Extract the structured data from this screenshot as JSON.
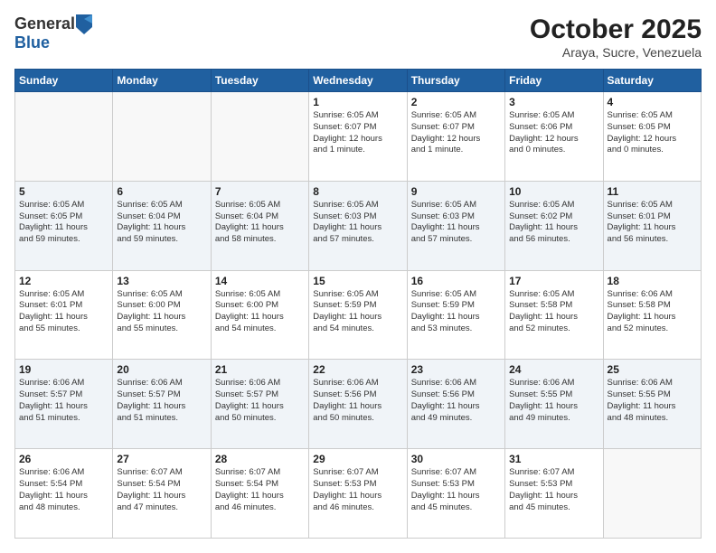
{
  "header": {
    "logo_general": "General",
    "logo_blue": "Blue",
    "month_title": "October 2025",
    "subtitle": "Araya, Sucre, Venezuela"
  },
  "weekdays": [
    "Sunday",
    "Monday",
    "Tuesday",
    "Wednesday",
    "Thursday",
    "Friday",
    "Saturday"
  ],
  "weeks": [
    [
      {
        "day": "",
        "info": ""
      },
      {
        "day": "",
        "info": ""
      },
      {
        "day": "",
        "info": ""
      },
      {
        "day": "1",
        "info": "Sunrise: 6:05 AM\nSunset: 6:07 PM\nDaylight: 12 hours\nand 1 minute."
      },
      {
        "day": "2",
        "info": "Sunrise: 6:05 AM\nSunset: 6:07 PM\nDaylight: 12 hours\nand 1 minute."
      },
      {
        "day": "3",
        "info": "Sunrise: 6:05 AM\nSunset: 6:06 PM\nDaylight: 12 hours\nand 0 minutes."
      },
      {
        "day": "4",
        "info": "Sunrise: 6:05 AM\nSunset: 6:05 PM\nDaylight: 12 hours\nand 0 minutes."
      }
    ],
    [
      {
        "day": "5",
        "info": "Sunrise: 6:05 AM\nSunset: 6:05 PM\nDaylight: 11 hours\nand 59 minutes."
      },
      {
        "day": "6",
        "info": "Sunrise: 6:05 AM\nSunset: 6:04 PM\nDaylight: 11 hours\nand 59 minutes."
      },
      {
        "day": "7",
        "info": "Sunrise: 6:05 AM\nSunset: 6:04 PM\nDaylight: 11 hours\nand 58 minutes."
      },
      {
        "day": "8",
        "info": "Sunrise: 6:05 AM\nSunset: 6:03 PM\nDaylight: 11 hours\nand 57 minutes."
      },
      {
        "day": "9",
        "info": "Sunrise: 6:05 AM\nSunset: 6:03 PM\nDaylight: 11 hours\nand 57 minutes."
      },
      {
        "day": "10",
        "info": "Sunrise: 6:05 AM\nSunset: 6:02 PM\nDaylight: 11 hours\nand 56 minutes."
      },
      {
        "day": "11",
        "info": "Sunrise: 6:05 AM\nSunset: 6:01 PM\nDaylight: 11 hours\nand 56 minutes."
      }
    ],
    [
      {
        "day": "12",
        "info": "Sunrise: 6:05 AM\nSunset: 6:01 PM\nDaylight: 11 hours\nand 55 minutes."
      },
      {
        "day": "13",
        "info": "Sunrise: 6:05 AM\nSunset: 6:00 PM\nDaylight: 11 hours\nand 55 minutes."
      },
      {
        "day": "14",
        "info": "Sunrise: 6:05 AM\nSunset: 6:00 PM\nDaylight: 11 hours\nand 54 minutes."
      },
      {
        "day": "15",
        "info": "Sunrise: 6:05 AM\nSunset: 5:59 PM\nDaylight: 11 hours\nand 54 minutes."
      },
      {
        "day": "16",
        "info": "Sunrise: 6:05 AM\nSunset: 5:59 PM\nDaylight: 11 hours\nand 53 minutes."
      },
      {
        "day": "17",
        "info": "Sunrise: 6:05 AM\nSunset: 5:58 PM\nDaylight: 11 hours\nand 52 minutes."
      },
      {
        "day": "18",
        "info": "Sunrise: 6:06 AM\nSunset: 5:58 PM\nDaylight: 11 hours\nand 52 minutes."
      }
    ],
    [
      {
        "day": "19",
        "info": "Sunrise: 6:06 AM\nSunset: 5:57 PM\nDaylight: 11 hours\nand 51 minutes."
      },
      {
        "day": "20",
        "info": "Sunrise: 6:06 AM\nSunset: 5:57 PM\nDaylight: 11 hours\nand 51 minutes."
      },
      {
        "day": "21",
        "info": "Sunrise: 6:06 AM\nSunset: 5:57 PM\nDaylight: 11 hours\nand 50 minutes."
      },
      {
        "day": "22",
        "info": "Sunrise: 6:06 AM\nSunset: 5:56 PM\nDaylight: 11 hours\nand 50 minutes."
      },
      {
        "day": "23",
        "info": "Sunrise: 6:06 AM\nSunset: 5:56 PM\nDaylight: 11 hours\nand 49 minutes."
      },
      {
        "day": "24",
        "info": "Sunrise: 6:06 AM\nSunset: 5:55 PM\nDaylight: 11 hours\nand 49 minutes."
      },
      {
        "day": "25",
        "info": "Sunrise: 6:06 AM\nSunset: 5:55 PM\nDaylight: 11 hours\nand 48 minutes."
      }
    ],
    [
      {
        "day": "26",
        "info": "Sunrise: 6:06 AM\nSunset: 5:54 PM\nDaylight: 11 hours\nand 48 minutes."
      },
      {
        "day": "27",
        "info": "Sunrise: 6:07 AM\nSunset: 5:54 PM\nDaylight: 11 hours\nand 47 minutes."
      },
      {
        "day": "28",
        "info": "Sunrise: 6:07 AM\nSunset: 5:54 PM\nDaylight: 11 hours\nand 46 minutes."
      },
      {
        "day": "29",
        "info": "Sunrise: 6:07 AM\nSunset: 5:53 PM\nDaylight: 11 hours\nand 46 minutes."
      },
      {
        "day": "30",
        "info": "Sunrise: 6:07 AM\nSunset: 5:53 PM\nDaylight: 11 hours\nand 45 minutes."
      },
      {
        "day": "31",
        "info": "Sunrise: 6:07 AM\nSunset: 5:53 PM\nDaylight: 11 hours\nand 45 minutes."
      },
      {
        "day": "",
        "info": ""
      }
    ]
  ]
}
